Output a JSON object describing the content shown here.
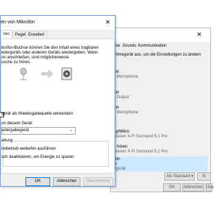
{
  "back_window": {
    "tabs": [
      "hme",
      "Sounds",
      "Kommunikation"
    ],
    "instruction": "ahmegerät aus, um die Einstellungen zu ändern",
    "devices": [
      {
        "name": "fon",
        "desc": "y Microphone"
      },
      {
        "name": "fon",
        "desc": "y Output"
      },
      {
        "name": "fon",
        "desc": "y Microphone"
      },
      {
        "name": "ng/Mikro",
        "desc": "Blaster X-Fi Surround 5.1 Pro"
      },
      {
        "name": "e hören",
        "desc": "Blaster X-Fi Surround 5.1 Pro"
      },
      {
        "name": "me",
        "desc": "ldegerät",
        "selected_line": "rofon"
      }
    ],
    "default_label": "Als Standard",
    "properties_label": "Ei",
    "buttons": {
      "ok": "OK",
      "cancel": "Abbrechen",
      "apply": "Übe"
    }
  },
  "front_window": {
    "title": "en von Mikrofon",
    "tabs": [
      "ren",
      "Pegel",
      "Erweitert"
    ],
    "desc_lines": [
      "krofon-Buchse können Sie den Inhalt eines tragbaren",
      "edergeräts oder anderen Geräts wiedergeben. Wenn",
      "on anschließen, sind möglicherweise",
      "usche zu hören."
    ],
    "listen_label": "gerät als Wiedergabequelle verwenden",
    "device_label": "on diesem Gerät:",
    "device_value": "edergabegerät",
    "group_title": "altung",
    "option1": "riebetrieb weiterhin ausführen",
    "option2": "sch deaktivieren, um Energie zu sparen",
    "buttons": {
      "ok": "OK",
      "cancel": "Abbrechen",
      "apply": "Übernehmen"
    }
  }
}
